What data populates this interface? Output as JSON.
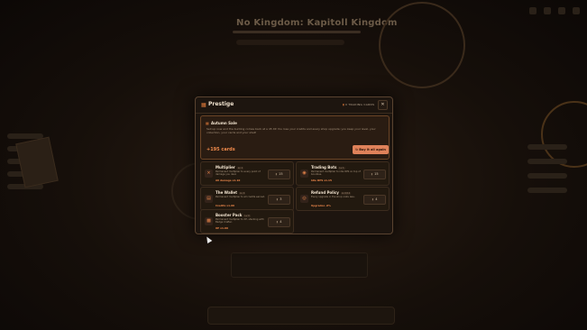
{
  "background": {
    "title": "No Kingdom: Kapitoll Kingdom"
  },
  "modal": {
    "title": "Prestige",
    "cards_label": "0 TRADING CARDS",
    "close_icon": "close-icon",
    "season": {
      "title": "Autumn Sale",
      "description": "Sell up now and the bunting comes back at a 45 XP. You lose your credits and every shop upgrade; you keep your level, your collection, your cards and your shelf.",
      "count": "+195 cards",
      "button_label": "Buy it all again"
    },
    "upgrades": [
      {
        "icon": "multiplier-icon",
        "name": "Multiplier",
        "level": "Lv 1",
        "description": "Permanent multiplier to every point of damage you deal.",
        "stat": "All damage x1.10",
        "cost": "15"
      },
      {
        "icon": "eye-icon",
        "name": "Trading Bots",
        "level": "Lv 1",
        "description": "Permanent multiplier to idle DPS on top of bounties.",
        "stat": "Idle DPS x1.15",
        "cost": "15"
      },
      {
        "icon": "wallet-icon",
        "name": "The Wallet",
        "level": "Lv 0",
        "description": "Permanent multiplier to all credits earned.",
        "stat": "Credits x1.00",
        "cost": "3"
      },
      {
        "icon": "refund-icon",
        "name": "Refund Policy",
        "level": "Lv 0/12",
        "description": "Every upgrade in the shop costs less.",
        "stat": "Upgrades -0%",
        "cost": "4"
      },
      {
        "icon": "booster-icon",
        "name": "Booster Pack",
        "level": "Lv 0",
        "description": "Permanent multiplier to XP, stacking with Badge Crafter.",
        "stat": "XP x1.00",
        "cost": "4"
      }
    ]
  }
}
